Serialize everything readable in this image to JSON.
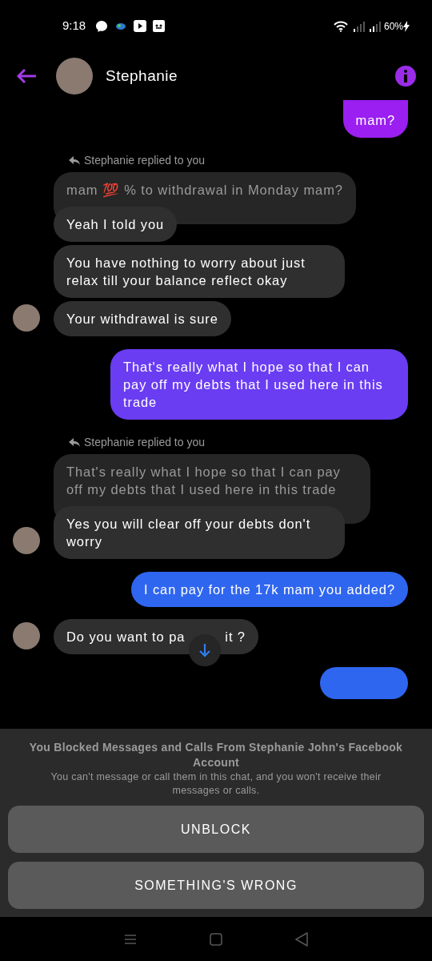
{
  "status_bar": {
    "time": "9:18",
    "battery": "60%"
  },
  "header": {
    "contact_name": "Stephanie"
  },
  "messages": [
    {
      "kind": "sent",
      "text": "mam?",
      "color": "#9a1ff0",
      "cut_top": true
    },
    {
      "kind": "reply_label",
      "text": "Stephanie replied to you"
    },
    {
      "kind": "quote",
      "text": "mam 💯 % to withdrawal in Monday mam?"
    },
    {
      "kind": "received",
      "text": "Yeah I told you",
      "avatar": false
    },
    {
      "kind": "received",
      "text": "You have nothing to worry about just relax till your balance reflect okay",
      "avatar": false
    },
    {
      "kind": "received",
      "text": "Your withdrawal is sure",
      "avatar": true
    },
    {
      "kind": "sent",
      "text": "That's really what I hope so that I can pay off my debts that I used here in this trade",
      "color": "#6a3df2",
      "cut_top": false
    },
    {
      "kind": "reply_label",
      "text": "Stephanie replied to you"
    },
    {
      "kind": "quote",
      "text": "That's really what I hope so that I can pay off my debts that I used here in this trade"
    },
    {
      "kind": "received",
      "text": "Yes you will clear off your debts don't worry",
      "avatar": true
    },
    {
      "kind": "sent",
      "text": "I can pay for the 17k mam you added?",
      "color": "#2f66f0",
      "cut_top": false
    },
    {
      "kind": "received_covered",
      "segments": [
        "Do you want to pa",
        "it ?"
      ],
      "avatar": true
    },
    {
      "kind": "covered",
      "color": "#2f66f0"
    }
  ],
  "blocked_panel": {
    "title": "You Blocked Messages and Calls From Stephanie John's Facebook Account",
    "note": "You can't message or call them in this chat, and you won't receive their messages or calls.",
    "buttons": [
      "UNBLOCK",
      "SOMETHING'S WRONG"
    ]
  }
}
